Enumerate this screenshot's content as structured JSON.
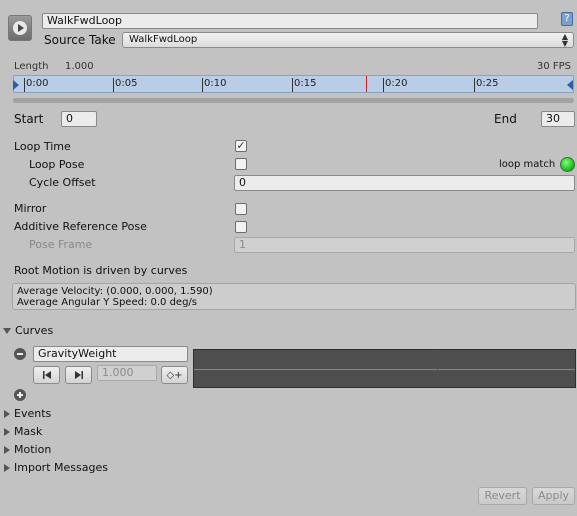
{
  "header": {
    "clip_name": "WalkFwdLoop",
    "source_take_label": "Source Take",
    "source_take_value": "WalkFwdLoop"
  },
  "timeline": {
    "length_label": "Length",
    "length_value": "1.000",
    "fps": "30 FPS",
    "ticks": [
      "0:00",
      "0:05",
      "0:10",
      "0:15",
      "0:20",
      "0:25"
    ]
  },
  "range": {
    "start_label": "Start",
    "start_value": "0",
    "end_label": "End",
    "end_value": "30"
  },
  "loop": {
    "loop_time_label": "Loop Time",
    "loop_time_checked": true,
    "loop_pose_label": "Loop Pose",
    "loop_match_label": "loop match",
    "cycle_offset_label": "Cycle Offset",
    "cycle_offset_value": "0"
  },
  "mirror_label": "Mirror",
  "additive": {
    "label": "Additive Reference Pose",
    "pose_frame_label": "Pose Frame",
    "pose_frame_value": "1"
  },
  "root_motion": {
    "title": "Root Motion is driven by curves",
    "line1": "Average Velocity: (0.000, 0.000, 1.590)",
    "line2": "Average Angular Y Speed: 0.0 deg/s"
  },
  "curves": {
    "section_label": "Curves",
    "curve_name": "GravityWeight",
    "curve_value": "1.000"
  },
  "sections": {
    "events": "Events",
    "mask": "Mask",
    "motion": "Motion",
    "import_messages": "Import Messages"
  },
  "buttons": {
    "revert": "Revert",
    "apply": "Apply"
  },
  "colors": {
    "loop_match_indicator": "#22c322",
    "curve_line": "#22d022",
    "playhead": "#c81e1e",
    "timeline_bg": "#b9cde6"
  }
}
